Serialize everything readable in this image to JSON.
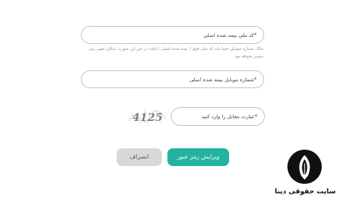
{
  "form": {
    "national_code_placeholder": "*کد ملی بیمه شده اصلی",
    "national_code_hint": "مالک شماره موبایل حتما باید کد ملی فوق ( بیمه شده اصلی ) باشد در غیر این صورت امکان تغییر رمز میسر نخواهد بود.",
    "mobile_placeholder": "*شماره موبایل بیمه شده اصلی",
    "captcha_image_text": "4125",
    "captcha_placeholder": "*عبارت مقابل را وارد کنید"
  },
  "actions": {
    "submit_label": "ویرایش رمز عبور",
    "cancel_label": "انصراف"
  },
  "watermark": {
    "site_name": "سایت حقوقی دینا"
  },
  "colors": {
    "primary": "#22b3a0",
    "cancel": "#d6d8da",
    "border": "#b9bec3"
  }
}
